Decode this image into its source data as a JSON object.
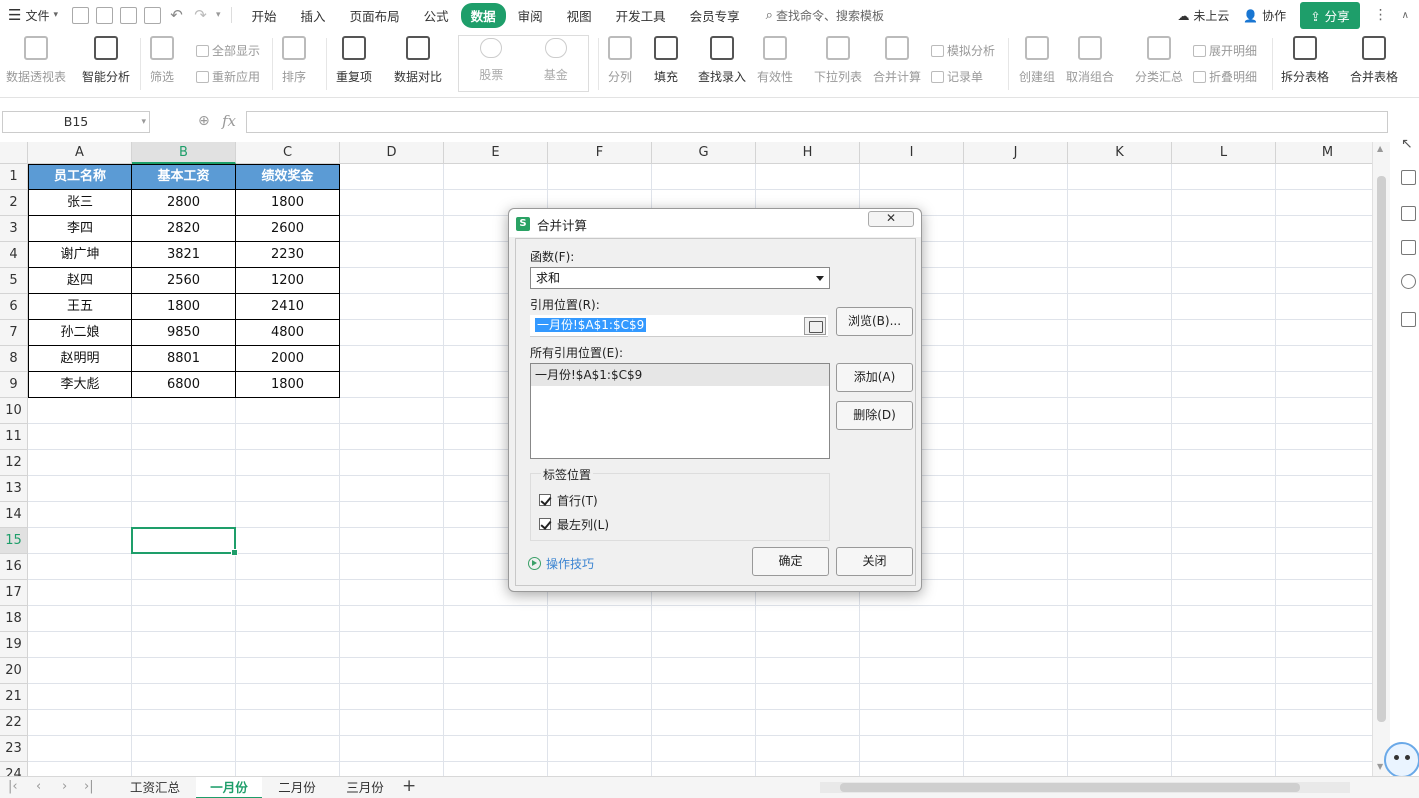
{
  "menubar": {
    "file_label": "文件",
    "tabs": [
      "开始",
      "插入",
      "页面布局",
      "公式",
      "数据",
      "审阅",
      "视图",
      "开发工具",
      "会员专享"
    ],
    "active_tab": "数据",
    "search_placeholder": "查找命令、搜索模板",
    "cloud_label": "未上云",
    "collab_label": "协作",
    "share_label": "分享"
  },
  "ribbon": {
    "pivot": "数据透视表",
    "smart_analysis": "智能分析",
    "filter": "筛选",
    "show_all": "全部显示",
    "reapply": "重新应用",
    "sort": "排序",
    "duplicates": "重复项",
    "data_compare": "数据对比",
    "stock": "股票",
    "fund": "基金",
    "split_column": "分列",
    "fill": "填充",
    "find_entry": "查找录入",
    "validity": "有效性",
    "dropdown_list": "下拉列表",
    "consolidate": "合并计算",
    "simulate": "模拟分析",
    "record_sheet": "记录单",
    "create_group": "创建组",
    "ungroup": "取消组合",
    "subtotal": "分类汇总",
    "expand_detail": "展开明细",
    "collapse_detail": "折叠明细",
    "split_table": "拆分表格",
    "merge_table": "合并表格"
  },
  "formula_bar": {
    "name_box": "B15",
    "fx": "fx",
    "value": ""
  },
  "sheet": {
    "columns": [
      "A",
      "B",
      "C",
      "D",
      "E",
      "F",
      "G",
      "H",
      "I",
      "J",
      "K",
      "L",
      "M"
    ],
    "rows": [
      "1",
      "2",
      "3",
      "4",
      "5",
      "6",
      "7",
      "8",
      "9",
      "10",
      "11",
      "12",
      "13",
      "14",
      "15",
      "16",
      "17",
      "18",
      "19",
      "20",
      "21",
      "22",
      "23",
      "24"
    ],
    "selected_column": "B",
    "selected_row": "15",
    "headers": [
      "员工名称",
      "基本工资",
      "绩效奖金"
    ],
    "data": [
      [
        "张三",
        "2800",
        "1800"
      ],
      [
        "李四",
        "2820",
        "2600"
      ],
      [
        "谢广坤",
        "3821",
        "2230"
      ],
      [
        "赵四",
        "2560",
        "1200"
      ],
      [
        "王五",
        "1800",
        "2410"
      ],
      [
        "孙二娘",
        "9850",
        "4800"
      ],
      [
        "赵明明",
        "8801",
        "2000"
      ],
      [
        "李大彪",
        "6800",
        "1800"
      ]
    ]
  },
  "dialog": {
    "title": "合并计算",
    "function_label": "函数(F):",
    "function_value": "求和",
    "ref_label": "引用位置(R):",
    "ref_value": "一月份!$A$1:$C$9",
    "browse": "浏览(B)...",
    "all_refs_label": "所有引用位置(E):",
    "all_refs": [
      "一月份!$A$1:$C$9"
    ],
    "add": "添加(A)",
    "delete": "删除(D)",
    "label_group": "标签位置",
    "first_row": "首行(T)",
    "first_row_checked": true,
    "left_col": "最左列(L)",
    "left_col_checked": true,
    "tips": "操作技巧",
    "ok": "确定",
    "close": "关闭"
  },
  "sheet_tabs": {
    "tabs": [
      "工资汇总",
      "一月份",
      "二月份",
      "三月份"
    ],
    "active": "一月份",
    "add": "+"
  },
  "colors": {
    "accent": "#1e9e6a",
    "header_fill": "#5b9bd5",
    "selection_blue": "#3399ff"
  }
}
